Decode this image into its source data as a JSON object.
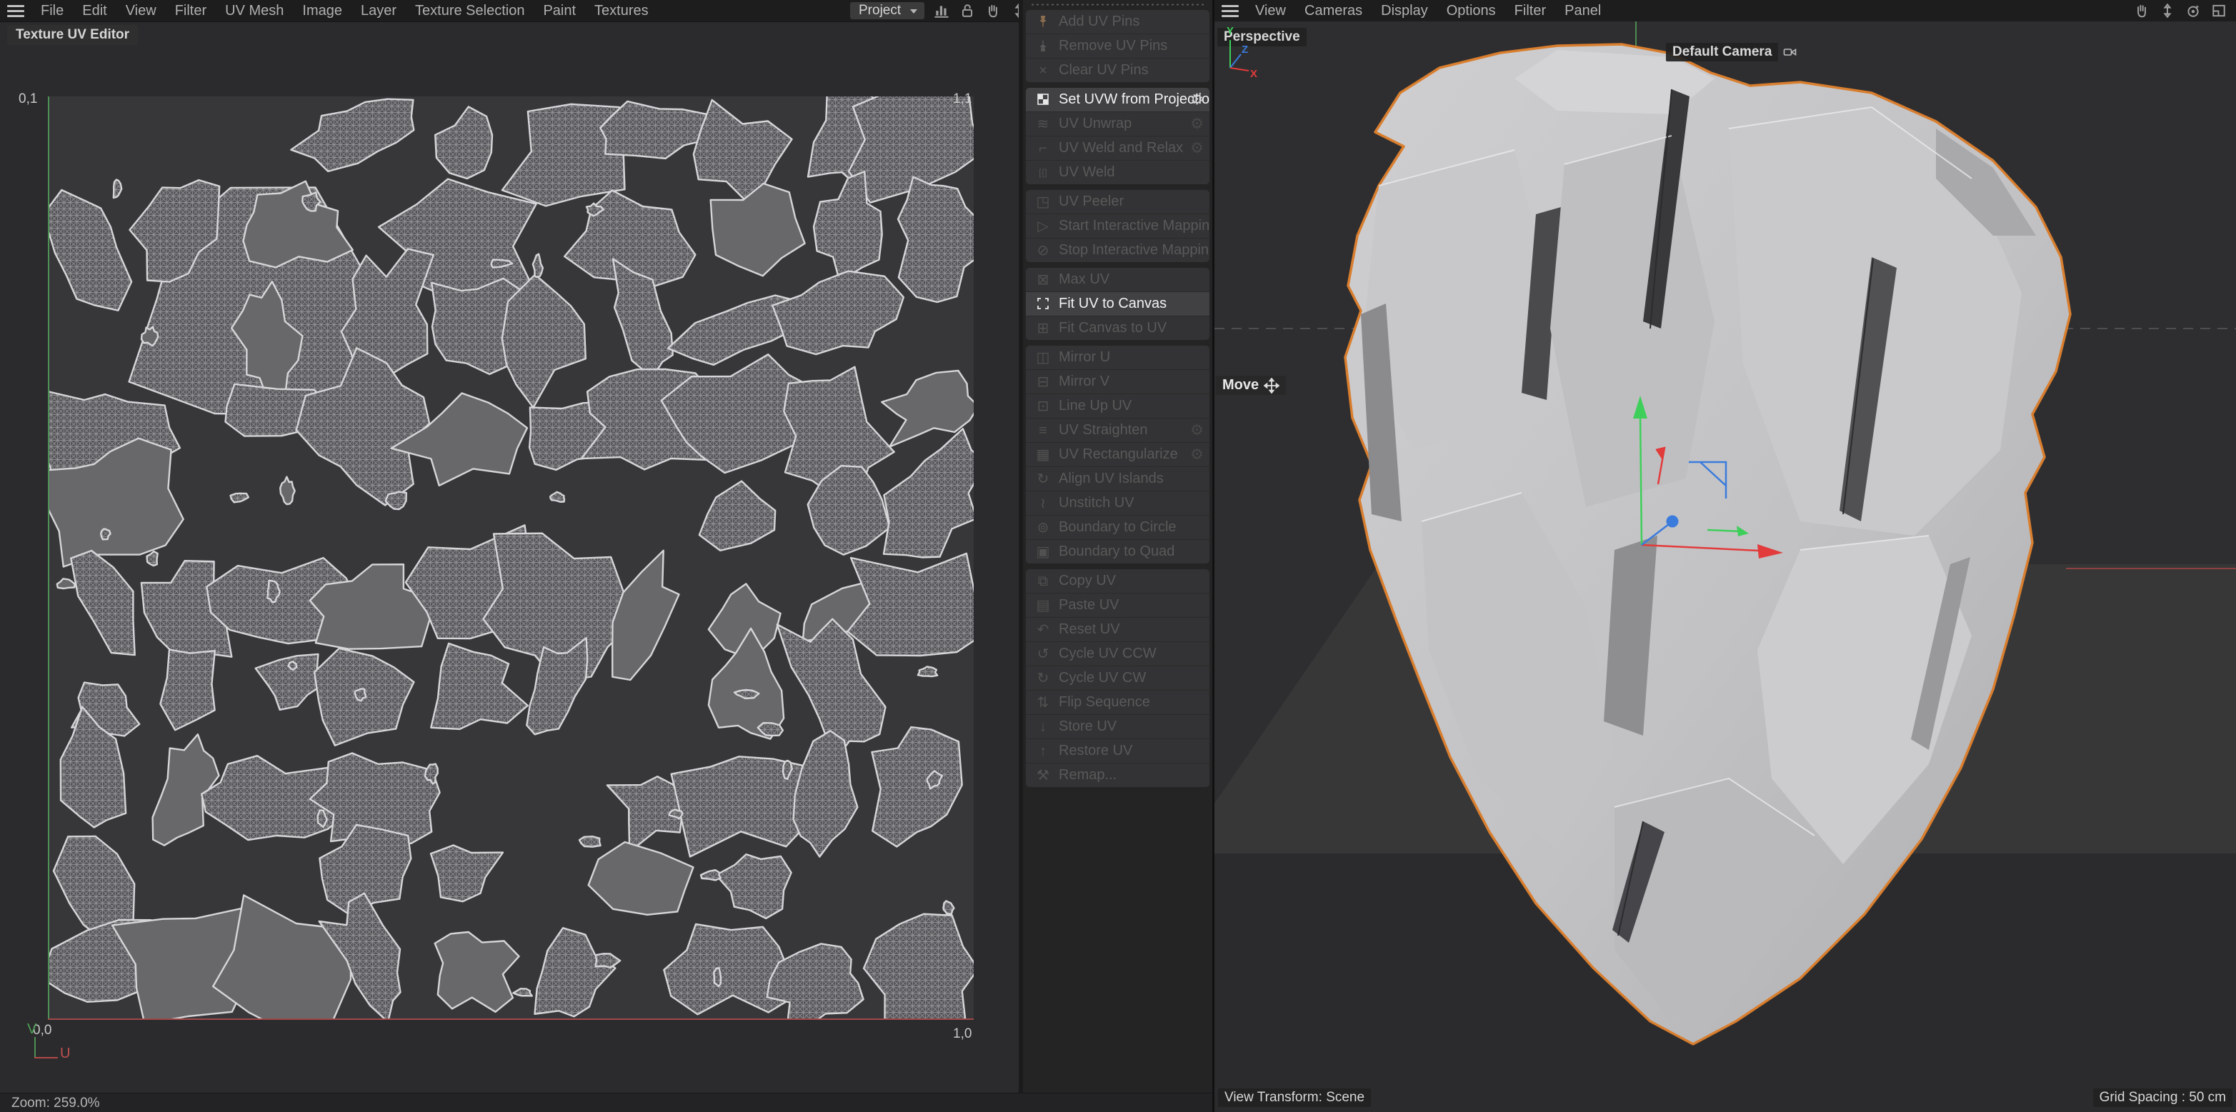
{
  "left_pane": {
    "menu": [
      "File",
      "Edit",
      "View",
      "Filter",
      "UV Mesh",
      "Image",
      "Layer",
      "Texture Selection",
      "Paint",
      "Textures"
    ],
    "tab_label": "Texture UV Editor",
    "project_dropdown": "Project",
    "toolbar_icons": [
      "histogram-icon",
      "lock-icon",
      "hand-icon",
      "updown-icon"
    ],
    "canvas": {
      "corner_top_left": "0,1",
      "corner_top_right": "1,1",
      "corner_bottom_left": "0,0",
      "corner_bottom_right": "1,0",
      "axis_u": "U",
      "axis_v": "V"
    },
    "status_zoom": "Zoom: 259.0%"
  },
  "command_panel": {
    "groups": [
      {
        "items": [
          {
            "label": "Add UV Pins",
            "icon": "pin-add-icon",
            "enabled": false,
            "settings": false
          },
          {
            "label": "Remove UV Pins",
            "icon": "pin-remove-icon",
            "enabled": false,
            "settings": false
          },
          {
            "label": "Clear UV Pins",
            "icon": "clear-pins-icon",
            "enabled": false,
            "settings": false
          }
        ]
      },
      {
        "items": [
          {
            "label": "Set UVW from Projection",
            "icon": "checker-icon",
            "enabled": true,
            "settings": true
          },
          {
            "label": "UV Unwrap",
            "icon": "unwrap-icon",
            "enabled": false,
            "settings": true
          },
          {
            "label": "UV Weld and Relax",
            "icon": "weld-relax-icon",
            "enabled": false,
            "settings": true
          },
          {
            "label": "UV Weld",
            "icon": "weld-icon",
            "enabled": false,
            "settings": false
          }
        ]
      },
      {
        "items": [
          {
            "label": "UV Peeler",
            "icon": "peeler-icon",
            "enabled": false,
            "settings": false
          },
          {
            "label": "Start Interactive Mapping",
            "icon": "play-icon",
            "enabled": false,
            "settings": false
          },
          {
            "label": "Stop Interactive Mapping",
            "icon": "ban-icon",
            "enabled": false,
            "settings": false
          }
        ]
      },
      {
        "items": [
          {
            "label": "Max UV",
            "icon": "max-uv-icon",
            "enabled": false,
            "settings": false
          },
          {
            "label": "Fit UV to Canvas",
            "icon": "fit-canvas-icon",
            "enabled": true,
            "settings": false
          },
          {
            "label": "Fit Canvas to UV",
            "icon": "fit-uv-icon",
            "enabled": false,
            "settings": false
          }
        ]
      },
      {
        "items": [
          {
            "label": "Mirror U",
            "icon": "mirror-u-icon",
            "enabled": false,
            "settings": false
          },
          {
            "label": "Mirror V",
            "icon": "mirror-v-icon",
            "enabled": false,
            "settings": false
          },
          {
            "label": "Line Up UV",
            "icon": "lineup-icon",
            "enabled": false,
            "settings": false
          },
          {
            "label": "UV Straighten",
            "icon": "straighten-icon",
            "enabled": false,
            "settings": true
          },
          {
            "label": "UV Rectangularize",
            "icon": "rectangularize-icon",
            "enabled": false,
            "settings": true
          },
          {
            "label": "Align UV Islands",
            "icon": "align-icon",
            "enabled": false,
            "settings": false
          },
          {
            "label": "Unstitch UV",
            "icon": "unstitch-icon",
            "enabled": false,
            "settings": false
          },
          {
            "label": "Boundary to Circle",
            "icon": "boundary-circle-icon",
            "enabled": false,
            "settings": false
          },
          {
            "label": "Boundary to Quad",
            "icon": "boundary-quad-icon",
            "enabled": false,
            "settings": false
          }
        ]
      },
      {
        "items": [
          {
            "label": "Copy UV",
            "icon": "copy-icon",
            "enabled": false,
            "settings": false
          },
          {
            "label": "Paste UV",
            "icon": "paste-icon",
            "enabled": false,
            "settings": false
          },
          {
            "label": "Reset UV",
            "icon": "reset-icon",
            "enabled": false,
            "settings": false
          },
          {
            "label": "Cycle UV CCW",
            "icon": "ccw-icon",
            "enabled": false,
            "settings": false
          },
          {
            "label": "Cycle UV CW",
            "icon": "cw-icon",
            "enabled": false,
            "settings": false
          },
          {
            "label": "Flip Sequence",
            "icon": "flip-icon",
            "enabled": false,
            "settings": false
          },
          {
            "label": "Store UV",
            "icon": "store-icon",
            "enabled": false,
            "settings": false
          },
          {
            "label": "Restore UV",
            "icon": "restore-icon",
            "enabled": false,
            "settings": false
          },
          {
            "label": "Remap...",
            "icon": "remap-icon",
            "enabled": false,
            "settings": false
          }
        ]
      }
    ]
  },
  "right_pane": {
    "menu": [
      "View",
      "Cameras",
      "Display",
      "Options",
      "Filter",
      "Panel"
    ],
    "toolbar_icons": [
      "hand-icon",
      "updown-icon",
      "orbit-icon",
      "pane-icon"
    ],
    "view_label": "Perspective",
    "camera_label": "Default Camera",
    "tool_tooltip": "Move",
    "status_left": "View Transform: Scene",
    "status_right": "Grid Spacing : 50 cm",
    "axis_gizmo": {
      "x": "X",
      "y": "Y",
      "z": "Z"
    }
  },
  "colors": {
    "selection_outline_orange": "#d97e2e",
    "axis_green": "#3ecf5a",
    "axis_red": "#e23b3b",
    "axis_blue": "#3a7bdc",
    "uv_axis_green": "#4d8f55",
    "uv_axis_red": "#a04848"
  }
}
